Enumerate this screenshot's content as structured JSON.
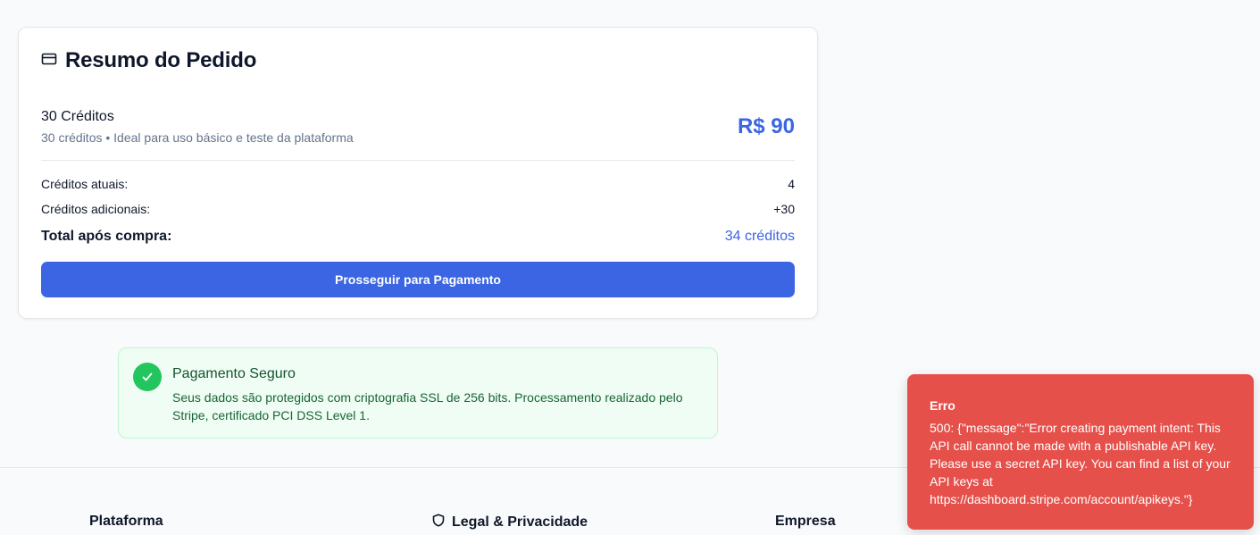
{
  "summary": {
    "title": "Resumo do Pedido",
    "item": {
      "name": "30 Créditos",
      "description": "30 créditos • Ideal para uso básico e teste da plataforma",
      "price": "R$ 90"
    },
    "current_credits_label": "Créditos atuais:",
    "current_credits_value": "4",
    "additional_credits_label": "Créditos adicionais:",
    "additional_credits_value": "+30",
    "total_label": "Total após compra:",
    "total_value": "34 créditos",
    "pay_button": "Prosseguir para Pagamento"
  },
  "secure": {
    "title": "Pagamento Seguro",
    "text": "Seus dados são protegidos com criptografia SSL de 256 bits. Processamento realizado pelo Stripe, certificado PCI DSS Level 1."
  },
  "footer": {
    "col1": "Plataforma",
    "col2": "Legal & Privacidade",
    "col3": "Empresa"
  },
  "toast": {
    "title": "Erro",
    "message": "500: {\"message\":\"Error creating payment intent: This API call cannot be made with a publishable API key. Please use a secret API key. You can find a list of your API keys at https://dashboard.stripe.com/account/apikeys.\"}"
  },
  "colors": {
    "accent": "#3b65e2",
    "success": "#22c55e",
    "error": "#e5504a"
  },
  "icons": {
    "summary": "credit-card-icon",
    "secure": "check-icon",
    "legal": "shield-icon"
  }
}
